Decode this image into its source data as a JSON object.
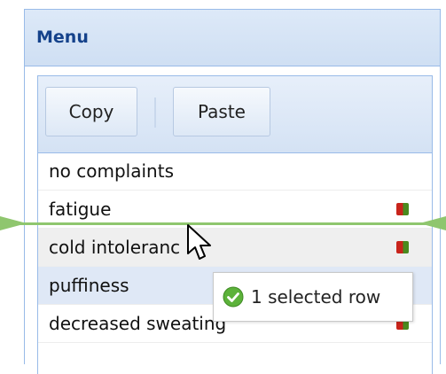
{
  "panel": {
    "title": "Menu"
  },
  "toolbar": {
    "copy_label": "Copy",
    "paste_label": "Paste"
  },
  "rows": [
    {
      "label": "no complaints",
      "has_icon": false
    },
    {
      "label": "fatigue",
      "has_icon": true
    },
    {
      "label": "cold intoleranc",
      "has_icon": true
    },
    {
      "label": "puffiness",
      "has_icon": true
    },
    {
      "label": "decreased sweating",
      "has_icon": true
    }
  ],
  "drag_tooltip": {
    "text": "1 selected row",
    "icon": "check-circle-icon"
  },
  "colors": {
    "header_text": "#15428b",
    "border": "#99bbe8",
    "selected_row": "#dfe8f6",
    "drop_indicator": "#8fc66e",
    "status_icon_red": "#c8241b",
    "status_icon_green": "#4a8a1e"
  }
}
